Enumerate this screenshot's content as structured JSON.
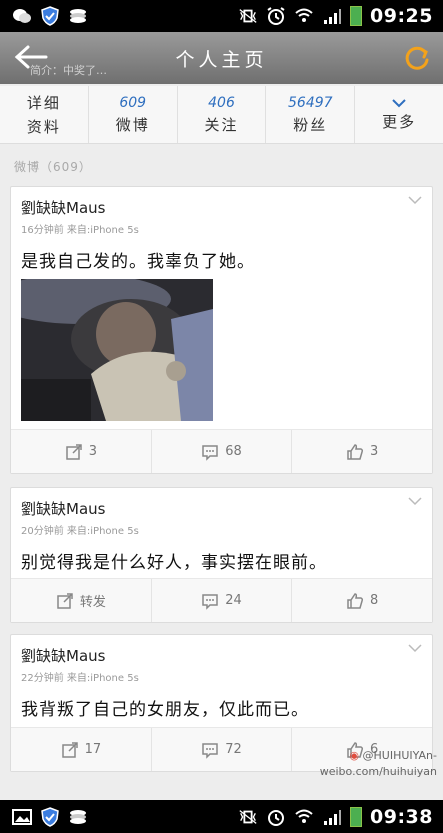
{
  "status_top": {
    "time": "09:25",
    "icons_left": [
      "wechat-icon",
      "shield-icon",
      "stack-icon"
    ],
    "icons_right": [
      "mute-vibrate-icon",
      "alarm-icon",
      "wifi-icon",
      "signal-icon",
      "battery-icon"
    ]
  },
  "header": {
    "title": "个人主页",
    "ghost_text": "简介：中奖了…"
  },
  "stats": [
    {
      "num": "",
      "label": "详细\n资料",
      "line1": "详细",
      "line2": "资料"
    },
    {
      "num": "609",
      "label": "微博"
    },
    {
      "num": "406",
      "label": "关注"
    },
    {
      "num": "56497",
      "label": "粉丝"
    },
    {
      "num": "",
      "label": "更多"
    }
  ],
  "section_label": "微博（609）",
  "posts": [
    {
      "author": "劉缺缺Maus",
      "meta": "16分钟前  来自:iPhone 5s",
      "text": "是我自己发的。我辜负了她。",
      "repost": "3",
      "comments": "68",
      "likes": "3"
    },
    {
      "author": "劉缺缺Maus",
      "meta": "20分钟前  来自:iPhone 5s",
      "text": "别觉得我是什么好人，事实摆在眼前。",
      "repost": "转发",
      "comments": "24",
      "likes": "8"
    },
    {
      "author": "劉缺缺Maus",
      "meta": "22分钟前  来自:iPhone 5s",
      "text": "我背叛了自己的女朋友，仅此而已。",
      "repost": "17",
      "comments": "72",
      "likes": "6"
    }
  ],
  "watermark": {
    "line1": "@HUIHUIYAn-",
    "line2": "weibo.com/huihuiyan"
  },
  "status_bottom": {
    "time": "09:38"
  },
  "colors": {
    "accent": "#2f6fbf",
    "statusbar": "#000000",
    "header": "#8a8a8a"
  }
}
